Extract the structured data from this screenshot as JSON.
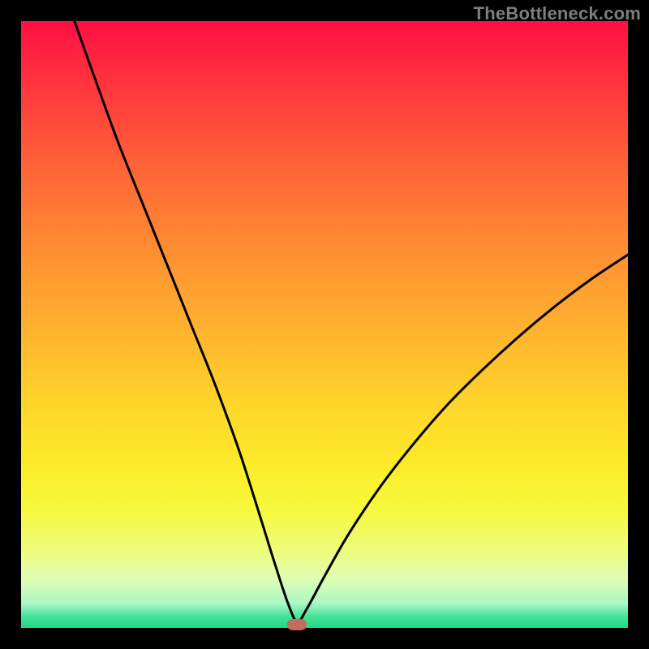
{
  "watermark": "TheBottleneck.com",
  "chart_data": {
    "type": "line",
    "title": "",
    "xlabel": "",
    "ylabel": "",
    "xlim": [
      0,
      1
    ],
    "ylim": [
      0,
      1
    ],
    "gradient_top_color": "#ff0f43",
    "gradient_bottom_color": "#1bd985",
    "curve_min_x": 0.455,
    "curve_min_y": 0.01,
    "curve_points_normalized": [
      {
        "x": 0.088,
        "y": 1.0
      },
      {
        "x": 0.12,
        "y": 0.91
      },
      {
        "x": 0.16,
        "y": 0.8
      },
      {
        "x": 0.2,
        "y": 0.7
      },
      {
        "x": 0.24,
        "y": 0.6
      },
      {
        "x": 0.28,
        "y": 0.5
      },
      {
        "x": 0.32,
        "y": 0.4
      },
      {
        "x": 0.36,
        "y": 0.29
      },
      {
        "x": 0.395,
        "y": 0.18
      },
      {
        "x": 0.42,
        "y": 0.1
      },
      {
        "x": 0.44,
        "y": 0.04
      },
      {
        "x": 0.455,
        "y": 0.01
      },
      {
        "x": 0.47,
        "y": 0.03
      },
      {
        "x": 0.5,
        "y": 0.085
      },
      {
        "x": 0.54,
        "y": 0.155
      },
      {
        "x": 0.59,
        "y": 0.23
      },
      {
        "x": 0.64,
        "y": 0.295
      },
      {
        "x": 0.7,
        "y": 0.365
      },
      {
        "x": 0.76,
        "y": 0.425
      },
      {
        "x": 0.82,
        "y": 0.48
      },
      {
        "x": 0.88,
        "y": 0.53
      },
      {
        "x": 0.94,
        "y": 0.575
      },
      {
        "x": 1.0,
        "y": 0.615
      }
    ],
    "marker": {
      "x": 0.455,
      "y": 0.005,
      "color": "#c46a5f"
    }
  }
}
